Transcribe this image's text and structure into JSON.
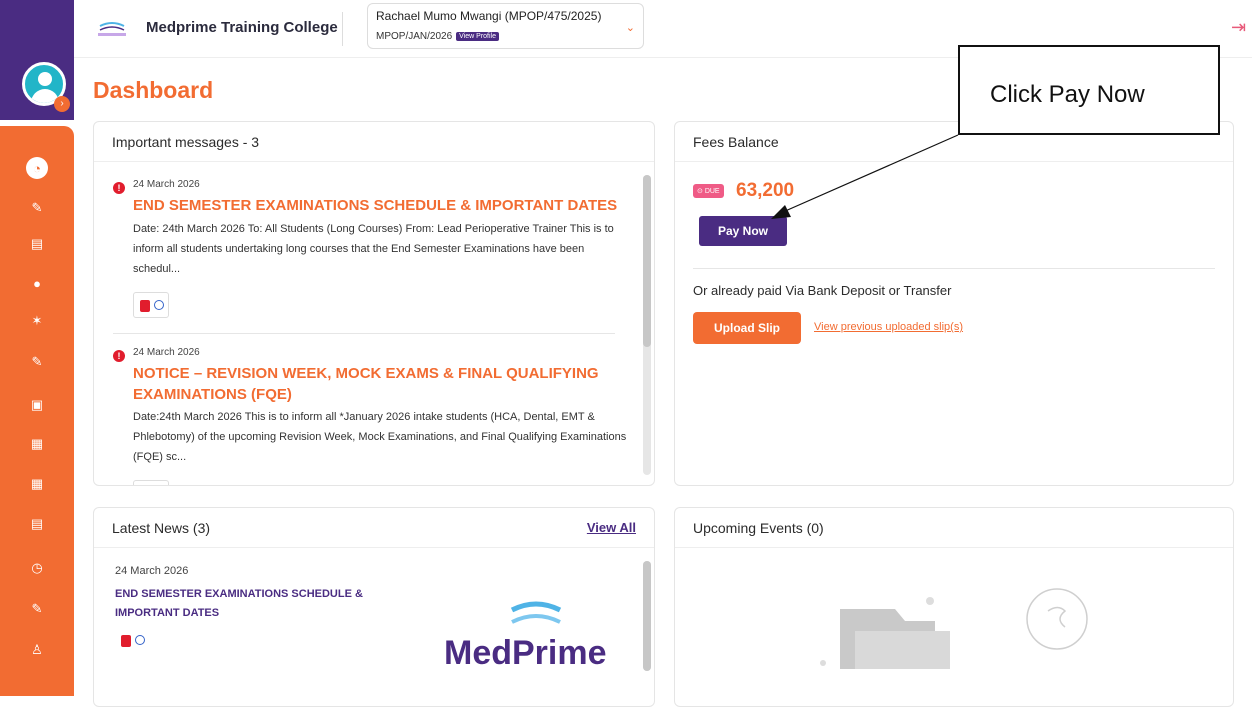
{
  "header": {
    "college_name": "Medprime Training College",
    "student_name": "Rachael Mumo Mwangi (MPOP/475/2025)",
    "student_code": "MPOP/JAN/2026",
    "view_profile": "View Profile"
  },
  "page_title": "Dashboard",
  "callout": "Click Pay Now",
  "messages": {
    "title": "Important messages - 3",
    "items": [
      {
        "date": "24 March 2026",
        "title": "END SEMESTER EXAMINATIONS SCHEDULE & IMPORTANT DATES",
        "body": "Date: 24th March 2026 To: All Students (Long Courses) From: Lead Perioperative Trainer This is to inform all students undertaking long courses that the End Semester Examinations have been schedul..."
      },
      {
        "date": "24 March 2026",
        "title": "NOTICE – REVISION WEEK, MOCK EXAMS & FINAL QUALIFYING EXAMINATIONS (FQE)",
        "body": "Date:24th March 2026 This is to inform all *January 2026 intake students (HCA, Dental, EMT & Phlebotomy) of the upcoming Revision Week, Mock Examinations, and Final Qualifying Examinations (FQE) sc..."
      }
    ]
  },
  "fees": {
    "title": "Fees Balance",
    "due_label": "DUE",
    "amount": "63,200",
    "pay_now": "Pay Now",
    "alt_text": "Or already paid Via Bank Deposit or Transfer",
    "upload_slip": "Upload Slip",
    "previous_slips": "View previous uploaded slip(s)"
  },
  "news": {
    "title": "Latest News (3)",
    "view_all": "View All",
    "items": [
      {
        "date": "24 March 2026",
        "title": "END SEMESTER EXAMINATIONS SCHEDULE & IMPORTANT DATES"
      }
    ],
    "logo_text": "MedPrime"
  },
  "events": {
    "title": "Upcoming Events (0)"
  },
  "colors": {
    "brand_orange": "#f26c32",
    "brand_purple": "#4a2c82"
  }
}
